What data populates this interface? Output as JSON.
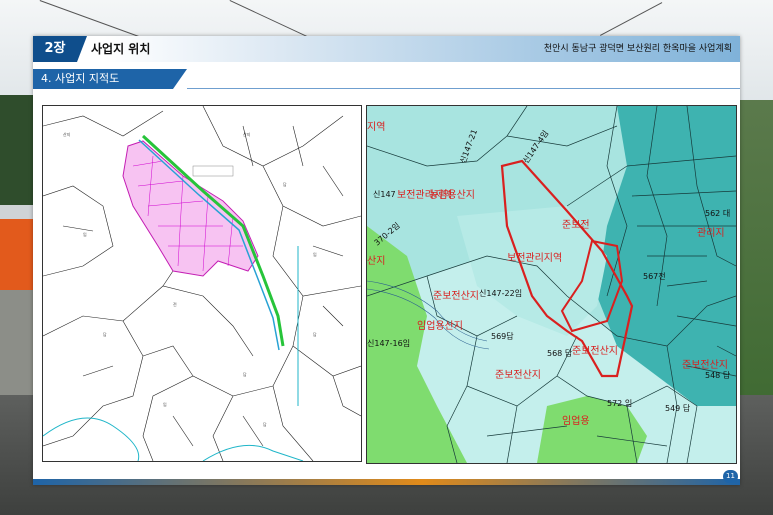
{
  "header": {
    "chapter": "2장",
    "title": "사업지 위치",
    "right_text": "천안시 동남구 광덕면 보산원리 한옥마을 사업계획"
  },
  "section": {
    "title": "4. 사업지 지적도"
  },
  "right_map": {
    "labels": [
      "지역",
      "보전관리지역",
      "농림용산지",
      "신147",
      "신147-21",
      "신147-4임",
      "370-2임",
      "산지",
      "준보전산지",
      "준보전산지",
      "신147-22임",
      "임업용산지",
      "신147-16임",
      "569답",
      "568 답",
      "준보전산지",
      "567전",
      "562 대",
      "관리지",
      "준보전",
      "보전관리지역",
      "준보전산지",
      "임업용",
      "572 임",
      "549 답",
      "548 답"
    ]
  },
  "page_number": "11",
  "colors": {
    "accent": "#1e64a8",
    "boundary_red": "#d9201f",
    "parcel_teal": "#3eb3b0",
    "forest_green": "#7fdc6f"
  }
}
